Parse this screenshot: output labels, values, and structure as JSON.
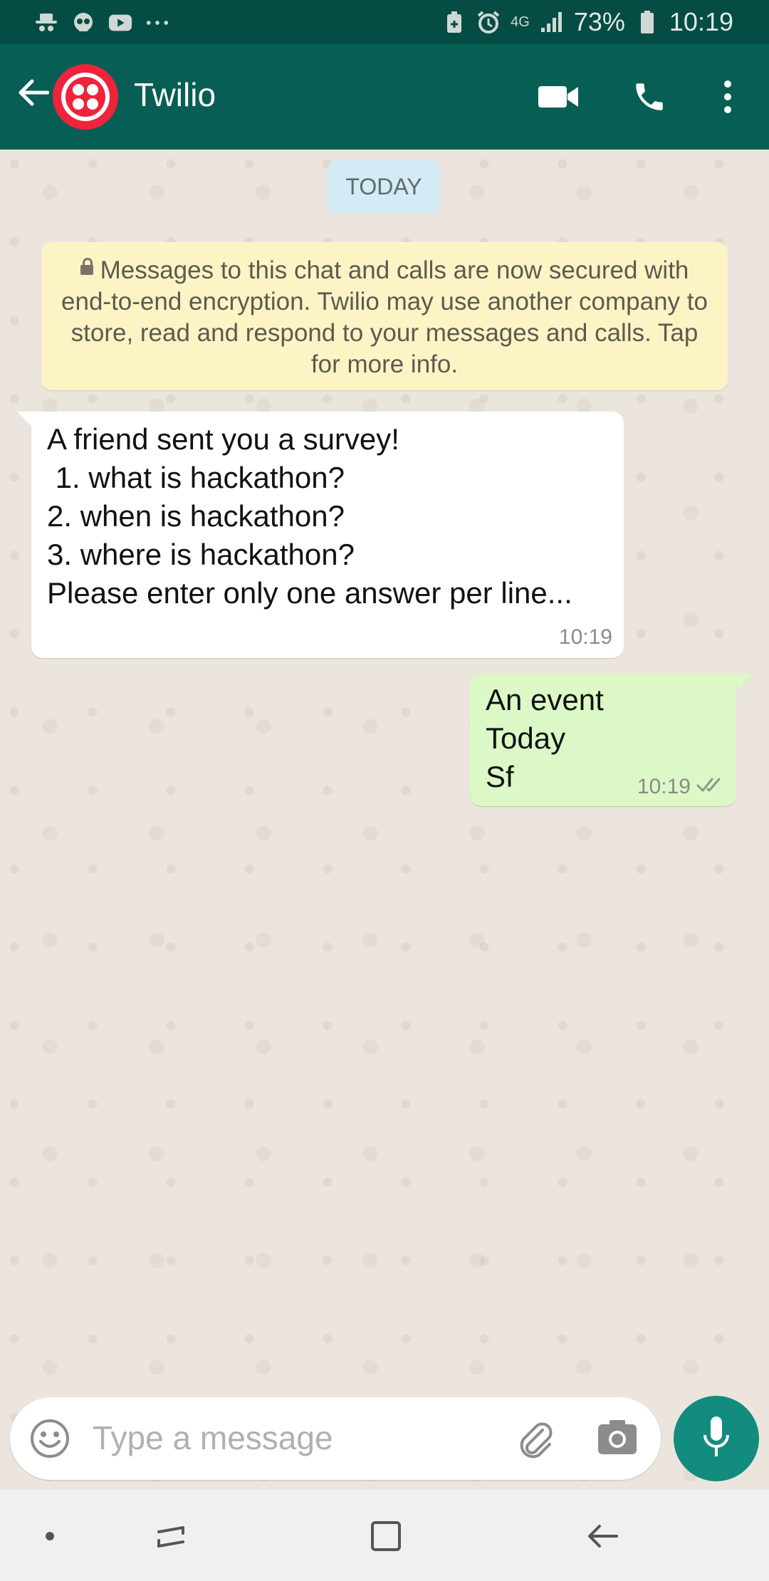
{
  "status_bar": {
    "left_icons": [
      "incognito-icon",
      "skull-icon",
      "youtube-icon",
      "more-dots-icon"
    ],
    "right_icons": [
      "battery-saver-icon",
      "alarm-icon",
      "network-4g-icon",
      "signal-icon",
      "battery-icon"
    ],
    "network": "4G",
    "battery": "73%",
    "time": "10:19"
  },
  "header": {
    "contact_name": "Twilio",
    "icons": [
      "back-arrow-icon",
      "video-call-icon",
      "phone-call-icon",
      "more-vert-icon"
    ],
    "avatar_color": "#ef233c",
    "bar_color": "#075e54"
  },
  "chat": {
    "date_label": "TODAY",
    "encryption_notice": "Messages to this chat and calls are now secured with end-to-end encryption. Twilio may use another company to store, read and respond to your messages and calls. Tap for more info.",
    "messages": [
      {
        "direction": "incoming",
        "text": "A friend sent you a survey!\n 1. what is hackathon?\n2. when is hackathon?\n3. where is hackathon?\nPlease enter only one answer per line...",
        "time": "10:19"
      },
      {
        "direction": "outgoing",
        "text": "An event\nToday\nSf",
        "time": "10:19",
        "status": "read-double-tick"
      }
    ]
  },
  "composer": {
    "placeholder": "Type a message",
    "icons": [
      "emoji-icon",
      "attach-icon",
      "camera-icon",
      "mic-icon"
    ],
    "mic_color": "#128c7e"
  },
  "nav_bar": {
    "icons": [
      "dot-icon",
      "recent-apps-icon",
      "home-icon",
      "back-icon"
    ]
  }
}
